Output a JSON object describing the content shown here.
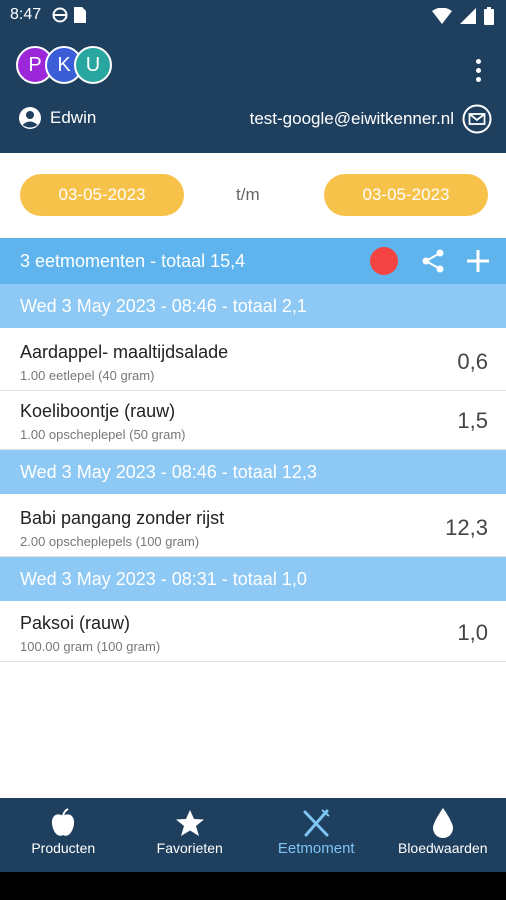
{
  "status_bar": {
    "time": "8:47"
  },
  "header": {
    "avatars": [
      "P",
      "K",
      "U"
    ],
    "user_name": "Edwin",
    "email": "test-google@eiwitkenner.nl"
  },
  "date_range": {
    "from": "03-05-2023",
    "separator": "t/m",
    "to": "03-05-2023"
  },
  "summary": {
    "text": "3 eetmomenten - totaal 15,4"
  },
  "groups": [
    {
      "title": "Wed 3 May 2023 - 08:46 - totaal 2,1",
      "items": [
        {
          "name": "Aardappel- maaltijdsalade",
          "amount": "1.00 eetlepel (40 gram)",
          "value": "0,6"
        },
        {
          "name": "Koeliboontje (rauw)",
          "amount": "1.00 opscheplepel (50 gram)",
          "value": "1,5"
        }
      ]
    },
    {
      "title": "Wed 3 May 2023 - 08:46 - totaal 12,3",
      "items": [
        {
          "name": "Babi pangang zonder rijst",
          "amount": "2.00 opscheplepels (100 gram)",
          "value": "12,3"
        }
      ]
    },
    {
      "title": "Wed 3 May 2023 - 08:31 - totaal 1,0",
      "items": [
        {
          "name": "Paksoi (rauw)",
          "amount": "100.00 gram (100 gram)",
          "value": "1,0"
        }
      ]
    }
  ],
  "bottom_nav": [
    {
      "label": "Producten",
      "icon": "apple-icon"
    },
    {
      "label": "Favorieten",
      "icon": "star-icon"
    },
    {
      "label": "Eetmoment",
      "icon": "cutlery-icon",
      "active": true
    },
    {
      "label": "Bloedwaarden",
      "icon": "drop-icon"
    }
  ],
  "colors": {
    "header_bg": "#1f3f5f",
    "accent_yellow": "#f7c24a",
    "summary_bg": "#5fb4ee",
    "group_bg": "#8ec9f5",
    "record_red": "#f44343",
    "active_nav": "#7ec4f5"
  }
}
